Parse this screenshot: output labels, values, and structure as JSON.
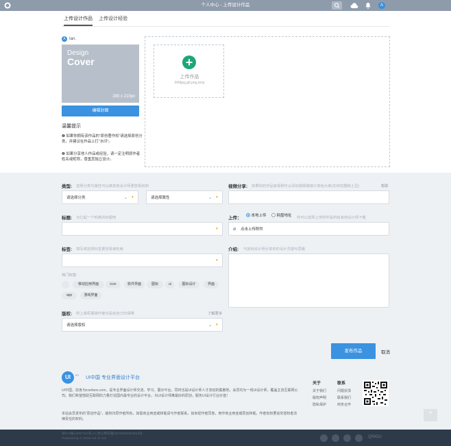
{
  "topbar": {
    "title": "个人中心 - 上传设计作品",
    "avatar_letter": "A",
    "icons": [
      "logo-icon",
      "search-icon",
      "cloud-icon",
      "bell-icon"
    ]
  },
  "tabs": [
    {
      "label": "上传设计作品",
      "active": true
    },
    {
      "label": "上传设计经验",
      "active": false
    }
  ],
  "user": {
    "avatar_letter": "A",
    "name": "Ian."
  },
  "cover": {
    "line1": "Design",
    "line2": "Cover",
    "size": "280 x 210px",
    "edit_button": "编辑封面"
  },
  "tips": {
    "title": "温馨提示",
    "items": [
      "❶ 如果你拥有该作品的“原创著作权”请选择原创分类，并建议在作品上打“水印”。",
      "❷ 如果分享他人作品或经验，请一定注明原作者姓名或昵称，尊重其独立设计。"
    ]
  },
  "upload": {
    "label": "上传作品",
    "hint": "30Mjpg,gif,png,bmp"
  },
  "form": {
    "category": {
      "label": "类型:",
      "hint": "选择分类与属性可以被其他设计师更容易找到",
      "select1": "请选择分类",
      "select2": "请选择属性"
    },
    "title": {
      "label": "标题:",
      "hint": "为它起一个响亮的标题吧"
    },
    "tags": {
      "label": "标签:",
      "hint": "填写或选择标签更容易被检索",
      "hot_label": "热门标签:",
      "hot_tags": [
        "移动应用界面",
        "icon",
        "软件界面",
        "图标",
        "ui",
        "图标设计",
        "界面",
        "app",
        "游戏界面"
      ]
    },
    "license": {
      "label": "版权:",
      "hint": "附上版权署授作者也是给自己的保障",
      "link": "了解更多",
      "select": "请选择版权"
    },
    "video": {
      "label": "视频分享:",
      "hint": "如果你的作品有视频可以添加视频链接分享给大家(支持优酷和土豆)",
      "help": "帮助"
    },
    "attachment": {
      "label": "上传：",
      "option_local": "本地上传",
      "option_net": "网盘地址",
      "hint": "你可以选择上传附件提供给其他设计师下载",
      "button": "点击上传附件"
    },
    "intro": {
      "label": "介绍:",
      "hint": "与其他设计师分享你的设计灵感与思路"
    },
    "publish_button": "发布作品",
    "cancel_link": "取消"
  },
  "footer": {
    "logo_text": "UI",
    "logo_sup": "cn",
    "brand": "UI中国  专业界面设计平台",
    "paragraph1": "UI中国，前身为iconfans.com，是专业界面设计师交流、学习、展示平台。同时也是UI设计师人才流动的集散地，会员均为一线UI设计师，覆盖主流互联网公司。我们希望借助互联网的力量打造国内最专业的设计平台，为UI设计师推最好的原创，服务UI设计行业价值！",
    "paragraph2": "本站会员发布的“原创作品”，版权归原作者所有，如需商业用途或转载请与作者联系。如未经作者同意，用作商业用途或原创转载，作者有权要追究侵权者法律责任的权利。",
    "col1": {
      "title": "关于",
      "links": [
        "关于我们",
        "版权声明",
        "隐私保护"
      ]
    },
    "col2": {
      "title": "联系",
      "links": [
        "问题反馈",
        "联系我们",
        "商务合作"
      ]
    },
    "copyright_lines": [
      "浙ICP备14007164号-3 | 浙公网安备33010802004816号",
      "Powered by © 2015 Ant UI CN"
    ],
    "partner": "QINGU"
  }
}
